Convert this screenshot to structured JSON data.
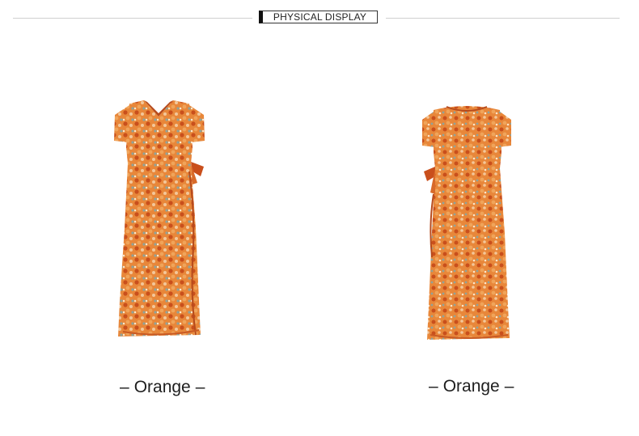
{
  "section": {
    "title": "PHYSICAL DISPLAY"
  },
  "products": [
    {
      "view": "front",
      "color_label": "Orange",
      "dash": "–"
    },
    {
      "view": "back",
      "color_label": "Orange",
      "dash": "–"
    }
  ],
  "colors": {
    "dress_base": "#e8873a",
    "dress_accent": "#f3c79a",
    "dress_dark": "#c94f1c",
    "text": "#1e1e1e"
  }
}
